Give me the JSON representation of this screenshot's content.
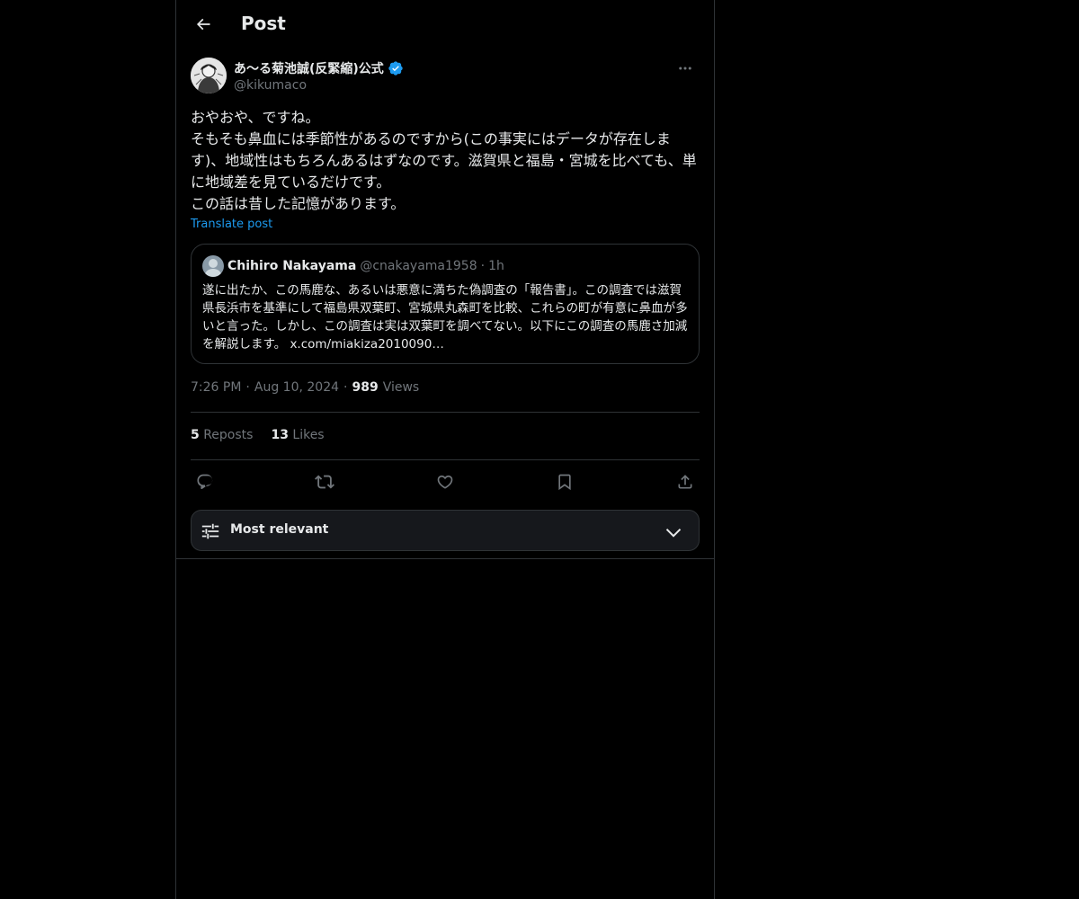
{
  "header": {
    "title": "Post"
  },
  "author": {
    "display_name": "あ〜る菊池誠(反緊縮)公式",
    "handle": "@kikumaco",
    "verified": true
  },
  "post": {
    "lines": [
      "おやおや、ですね。",
      "そもそも鼻血には季節性があるのですから(この事実にはデータが存在します)、地域性はもちろんあるはずなのです。滋賀県と福島・宮城を比べても、単に地域差を見ているだけです。",
      "この話は昔した記憶があります。"
    ],
    "translate_label": "Translate post"
  },
  "quote": {
    "name": "Chihiro Nakayama",
    "handle": "@cnakayama1958",
    "separator": "·",
    "time": "1h",
    "text": "遂に出たか、この馬鹿な、あるいは悪意に満ちた偽調査の「報告書」。この調査では滋賀県長浜市を基準にして福島県双葉町、宮城県丸森町を比較、これらの町が有意に鼻血が多いと言った。しかし、この調査は実は双葉町を調べてない。以下にこの調査の馬鹿さ加減を解説します。 x.com/miakiza2010090…"
  },
  "meta": {
    "time": "7:26 PM",
    "dot1": "·",
    "date": "Aug 10, 2024",
    "dot2": "·",
    "views_count": "989",
    "views_label": "Views"
  },
  "stats": {
    "reposts_count": "5",
    "reposts_label": "Reposts",
    "likes_count": "13",
    "likes_label": "Likes"
  },
  "actions": [
    "reply-icon",
    "repost-icon",
    "like-icon",
    "bookmark-icon",
    "share-icon"
  ],
  "sort": {
    "label": "Most relevant"
  },
  "colors": {
    "background": "#000000",
    "text": "#e7e9ea",
    "muted": "#71767b",
    "link": "#1d9bf0",
    "border": "#2f3336",
    "verified": "#1d9bf0"
  }
}
